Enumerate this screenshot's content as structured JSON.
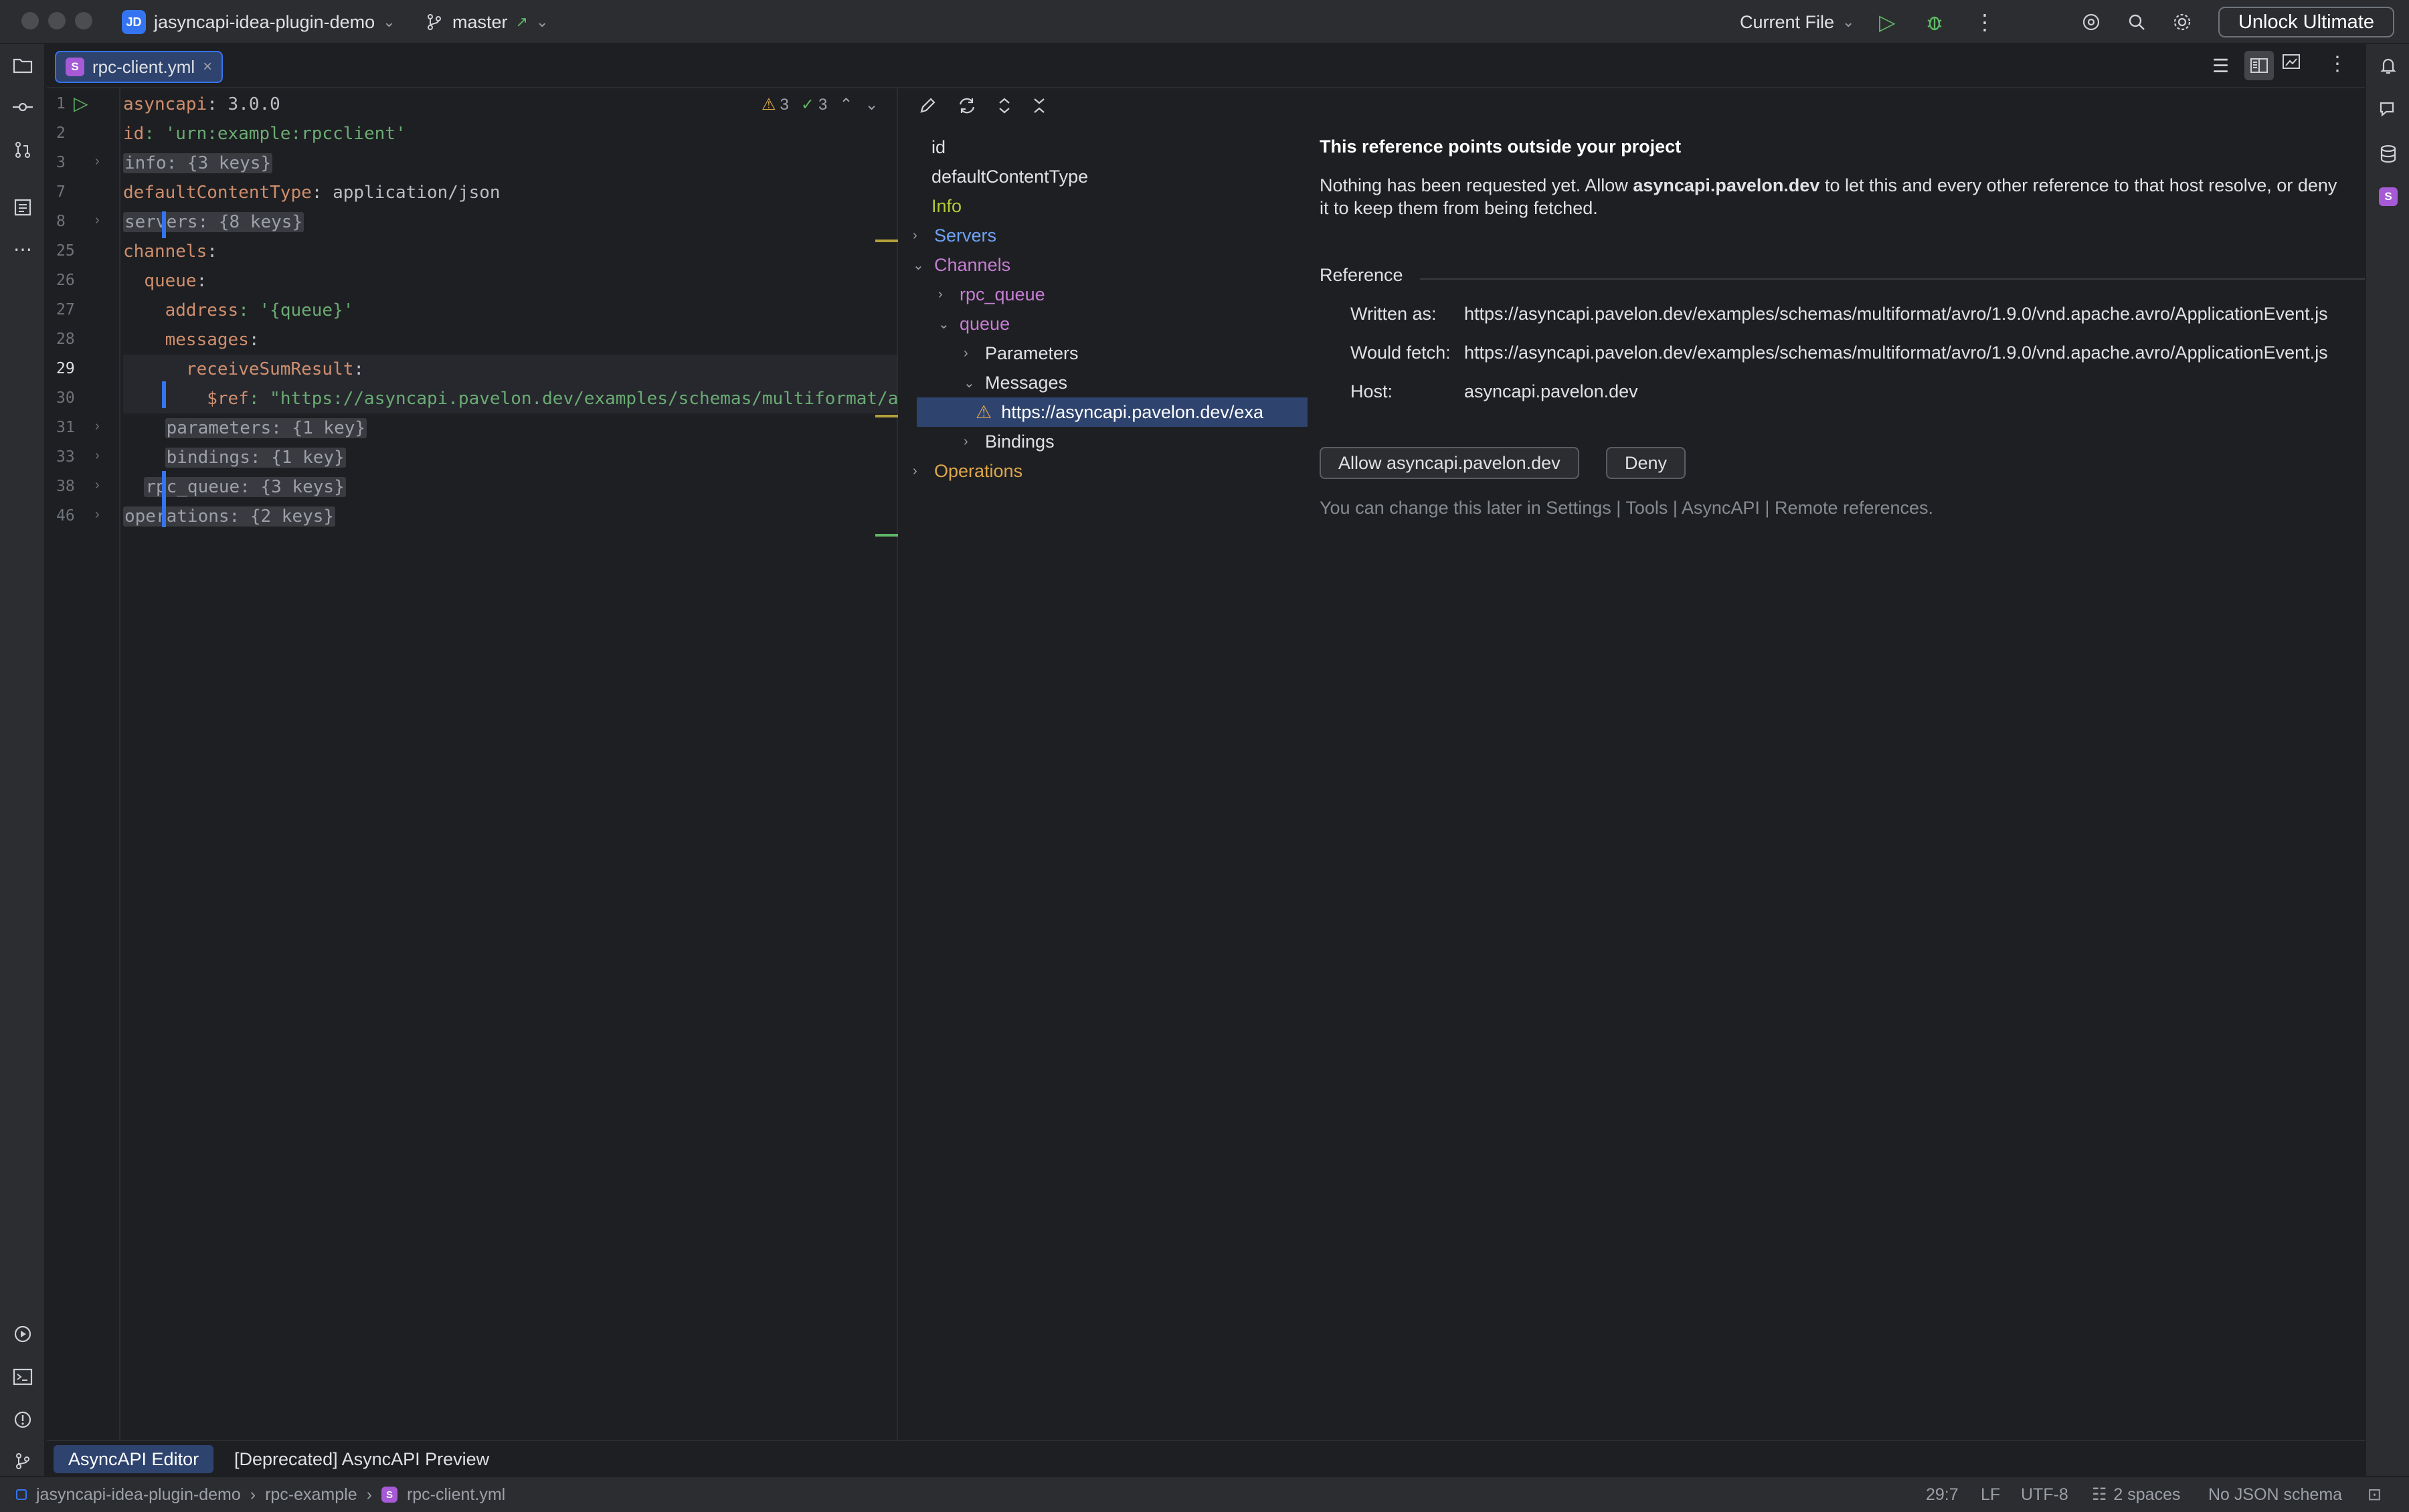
{
  "titlebar": {
    "project_badge": "JD",
    "project_name": "jasyncapi-idea-plugin-demo",
    "branch": "master",
    "run_config": "Current File",
    "unlock": "Unlock Ultimate"
  },
  "tab": {
    "label": "rpc-client.yml",
    "icon_letter": "S"
  },
  "editor": {
    "inspections": {
      "warnings": "3",
      "ok": "3"
    },
    "lines": [
      {
        "num": "1",
        "indent": "",
        "key": "asyncapi",
        "rest": ": 3.0.0"
      },
      {
        "num": "2",
        "indent": "",
        "key": "id",
        "rest": ": 'urn:example:rpcclient'"
      },
      {
        "num": "3",
        "indent": "",
        "folded": "info: {3 keys}"
      },
      {
        "num": "7",
        "indent": "",
        "key": "defaultContentType",
        "rest": ": application/json"
      },
      {
        "num": "8",
        "indent": "",
        "folded": "servers: {8 keys}"
      },
      {
        "num": "25",
        "indent": "",
        "key": "channels",
        "rest": ":"
      },
      {
        "num": "26",
        "indent": "  ",
        "key": "queue",
        "rest": ":"
      },
      {
        "num": "27",
        "indent": "    ",
        "key": "address",
        "rest": ": '{queue}'"
      },
      {
        "num": "28",
        "indent": "    ",
        "key": "messages",
        "rest": ":"
      },
      {
        "num": "29",
        "indent": "      ",
        "key": "receiveSumResult",
        "rest": ":"
      },
      {
        "num": "30",
        "indent": "        ",
        "key": "$ref",
        "rest": ": \"https://asyncapi.pavelon.dev/examples/schemas/multiformat/a"
      },
      {
        "num": "31",
        "indent": "    ",
        "folded": "parameters: {1 key}"
      },
      {
        "num": "33",
        "indent": "    ",
        "folded": "bindings: {1 key}"
      },
      {
        "num": "38",
        "indent": "  ",
        "folded": "rpc_queue: {3 keys}"
      },
      {
        "num": "46",
        "indent": "",
        "folded": "operations: {2 keys}"
      }
    ]
  },
  "tree": {
    "items": [
      {
        "label": "id",
        "arrow": "",
        "color": "#dfe1e5"
      },
      {
        "label": "defaultContentType",
        "arrow": "",
        "color": "#dfe1e5"
      },
      {
        "label": "Info",
        "arrow": "",
        "color": "#b3c93a"
      },
      {
        "label": "Servers",
        "arrow": "›",
        "color": "#6ea3f5"
      },
      {
        "label": "Channels",
        "arrow": "⌄",
        "color": "#c77dd5"
      },
      {
        "label": "rpc_queue",
        "arrow": "›",
        "color": "#c77dd5"
      },
      {
        "label": "queue",
        "arrow": "⌄",
        "color": "#c77dd5"
      },
      {
        "label": "Parameters",
        "arrow": "›",
        "color": "#dfe1e5"
      },
      {
        "label": "Messages",
        "arrow": "⌄",
        "color": "#dfe1e5"
      },
      {
        "label": "https://asyncapi.pavelon.dev/exa",
        "arrow": "",
        "color": "#ffffff"
      },
      {
        "label": "Bindings",
        "arrow": "›",
        "color": "#dfe1e5"
      },
      {
        "label": "Operations",
        "arrow": "›",
        "color": "#e0a84a"
      }
    ]
  },
  "info": {
    "heading": "This reference points outside your project",
    "desc_pre": "Nothing has been requested yet. Allow ",
    "desc_host": "asyncapi.pavelon.dev",
    "desc_post": " to let this and every other reference to that host resolve, or deny",
    "desc_line2": "it to keep them from being fetched.",
    "section": "Reference",
    "written_label": "Written as:",
    "written_value": "https://asyncapi.pavelon.dev/examples/schemas/multiformat/avro/1.9.0/vnd.apache.avro/ApplicationEvent.js",
    "fetch_label": "Would fetch:",
    "fetch_value": "https://asyncapi.pavelon.dev/examples/schemas/multiformat/avro/1.9.0/vnd.apache.avro/ApplicationEvent.js",
    "host_label": "Host:",
    "host_value": "asyncapi.pavelon.dev",
    "allow_button": "Allow asyncapi.pavelon.dev",
    "deny_button": "Deny",
    "hint": "You can change this later in Settings | Tools | AsyncAPI | Remote references."
  },
  "bottom_tabs": {
    "active": "AsyncAPI Editor",
    "other": "[Deprecated] AsyncAPI Preview"
  },
  "statusbar": {
    "crumbs": [
      "jasyncapi-idea-plugin-demo",
      "rpc-example",
      "rpc-client.yml"
    ],
    "position": "29:7",
    "line_sep": "LF",
    "encoding": "UTF-8",
    "indent": "2 spaces",
    "schema": "No JSON schema"
  }
}
